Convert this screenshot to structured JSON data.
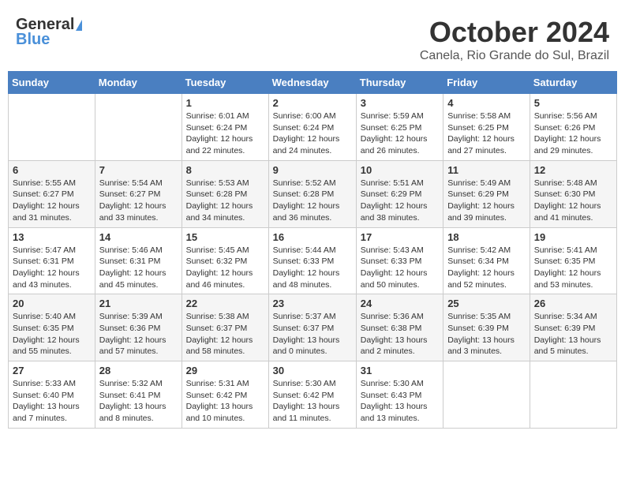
{
  "logo": {
    "general": "General",
    "blue": "Blue"
  },
  "title": "October 2024",
  "location": "Canela, Rio Grande do Sul, Brazil",
  "days_of_week": [
    "Sunday",
    "Monday",
    "Tuesday",
    "Wednesday",
    "Thursday",
    "Friday",
    "Saturday"
  ],
  "weeks": [
    [
      {
        "day": "",
        "info": ""
      },
      {
        "day": "",
        "info": ""
      },
      {
        "day": "1",
        "info": "Sunrise: 6:01 AM\nSunset: 6:24 PM\nDaylight: 12 hours and 22 minutes."
      },
      {
        "day": "2",
        "info": "Sunrise: 6:00 AM\nSunset: 6:24 PM\nDaylight: 12 hours and 24 minutes."
      },
      {
        "day": "3",
        "info": "Sunrise: 5:59 AM\nSunset: 6:25 PM\nDaylight: 12 hours and 26 minutes."
      },
      {
        "day": "4",
        "info": "Sunrise: 5:58 AM\nSunset: 6:25 PM\nDaylight: 12 hours and 27 minutes."
      },
      {
        "day": "5",
        "info": "Sunrise: 5:56 AM\nSunset: 6:26 PM\nDaylight: 12 hours and 29 minutes."
      }
    ],
    [
      {
        "day": "6",
        "info": "Sunrise: 5:55 AM\nSunset: 6:27 PM\nDaylight: 12 hours and 31 minutes."
      },
      {
        "day": "7",
        "info": "Sunrise: 5:54 AM\nSunset: 6:27 PM\nDaylight: 12 hours and 33 minutes."
      },
      {
        "day": "8",
        "info": "Sunrise: 5:53 AM\nSunset: 6:28 PM\nDaylight: 12 hours and 34 minutes."
      },
      {
        "day": "9",
        "info": "Sunrise: 5:52 AM\nSunset: 6:28 PM\nDaylight: 12 hours and 36 minutes."
      },
      {
        "day": "10",
        "info": "Sunrise: 5:51 AM\nSunset: 6:29 PM\nDaylight: 12 hours and 38 minutes."
      },
      {
        "day": "11",
        "info": "Sunrise: 5:49 AM\nSunset: 6:29 PM\nDaylight: 12 hours and 39 minutes."
      },
      {
        "day": "12",
        "info": "Sunrise: 5:48 AM\nSunset: 6:30 PM\nDaylight: 12 hours and 41 minutes."
      }
    ],
    [
      {
        "day": "13",
        "info": "Sunrise: 5:47 AM\nSunset: 6:31 PM\nDaylight: 12 hours and 43 minutes."
      },
      {
        "day": "14",
        "info": "Sunrise: 5:46 AM\nSunset: 6:31 PM\nDaylight: 12 hours and 45 minutes."
      },
      {
        "day": "15",
        "info": "Sunrise: 5:45 AM\nSunset: 6:32 PM\nDaylight: 12 hours and 46 minutes."
      },
      {
        "day": "16",
        "info": "Sunrise: 5:44 AM\nSunset: 6:33 PM\nDaylight: 12 hours and 48 minutes."
      },
      {
        "day": "17",
        "info": "Sunrise: 5:43 AM\nSunset: 6:33 PM\nDaylight: 12 hours and 50 minutes."
      },
      {
        "day": "18",
        "info": "Sunrise: 5:42 AM\nSunset: 6:34 PM\nDaylight: 12 hours and 52 minutes."
      },
      {
        "day": "19",
        "info": "Sunrise: 5:41 AM\nSunset: 6:35 PM\nDaylight: 12 hours and 53 minutes."
      }
    ],
    [
      {
        "day": "20",
        "info": "Sunrise: 5:40 AM\nSunset: 6:35 PM\nDaylight: 12 hours and 55 minutes."
      },
      {
        "day": "21",
        "info": "Sunrise: 5:39 AM\nSunset: 6:36 PM\nDaylight: 12 hours and 57 minutes."
      },
      {
        "day": "22",
        "info": "Sunrise: 5:38 AM\nSunset: 6:37 PM\nDaylight: 12 hours and 58 minutes."
      },
      {
        "day": "23",
        "info": "Sunrise: 5:37 AM\nSunset: 6:37 PM\nDaylight: 13 hours and 0 minutes."
      },
      {
        "day": "24",
        "info": "Sunrise: 5:36 AM\nSunset: 6:38 PM\nDaylight: 13 hours and 2 minutes."
      },
      {
        "day": "25",
        "info": "Sunrise: 5:35 AM\nSunset: 6:39 PM\nDaylight: 13 hours and 3 minutes."
      },
      {
        "day": "26",
        "info": "Sunrise: 5:34 AM\nSunset: 6:39 PM\nDaylight: 13 hours and 5 minutes."
      }
    ],
    [
      {
        "day": "27",
        "info": "Sunrise: 5:33 AM\nSunset: 6:40 PM\nDaylight: 13 hours and 7 minutes."
      },
      {
        "day": "28",
        "info": "Sunrise: 5:32 AM\nSunset: 6:41 PM\nDaylight: 13 hours and 8 minutes."
      },
      {
        "day": "29",
        "info": "Sunrise: 5:31 AM\nSunset: 6:42 PM\nDaylight: 13 hours and 10 minutes."
      },
      {
        "day": "30",
        "info": "Sunrise: 5:30 AM\nSunset: 6:42 PM\nDaylight: 13 hours and 11 minutes."
      },
      {
        "day": "31",
        "info": "Sunrise: 5:30 AM\nSunset: 6:43 PM\nDaylight: 13 hours and 13 minutes."
      },
      {
        "day": "",
        "info": ""
      },
      {
        "day": "",
        "info": ""
      }
    ]
  ]
}
